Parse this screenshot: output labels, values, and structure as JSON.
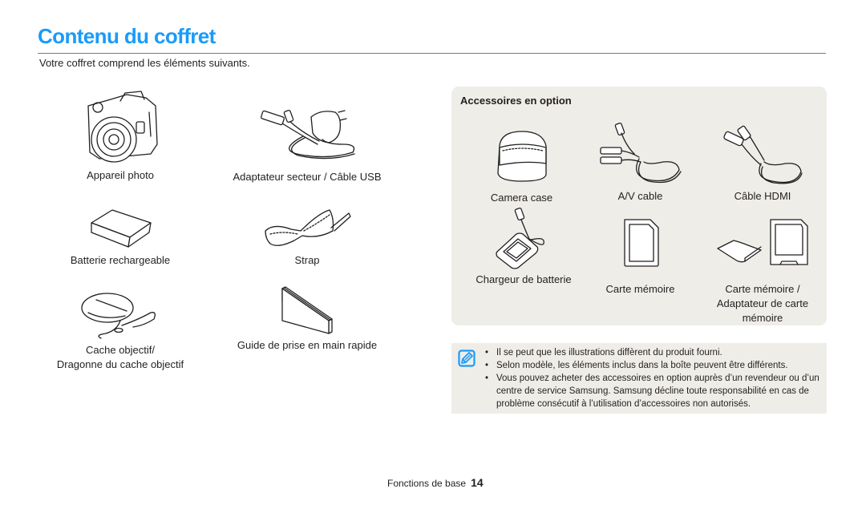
{
  "page": {
    "title": "Contenu du coffret",
    "intro": "Votre coffret comprend les éléments suivants.",
    "accent_color": "#1a9bfa",
    "panel_color": "#efede8"
  },
  "included_items": [
    {
      "icon": "camera-icon",
      "label": "Appareil photo"
    },
    {
      "icon": "adapter-usb-cable-icon",
      "label": "Adaptateur secteur / Câble USB"
    },
    {
      "icon": "battery-icon",
      "label": "Batterie rechargeable"
    },
    {
      "icon": "strap-icon",
      "label": "Strap"
    },
    {
      "icon": "lens-cap-icon",
      "label_line1": "Cache objectif/",
      "label_line2": "Dragonne du cache objectif"
    },
    {
      "icon": "quick-guide-icon",
      "label": "Guide de prise en main rapide"
    }
  ],
  "optional": {
    "heading": "Accessoires en option",
    "items": [
      {
        "icon": "camera-case-icon",
        "label": "Camera case"
      },
      {
        "icon": "av-cable-icon",
        "label": "A/V cable"
      },
      {
        "icon": "hdmi-cable-icon",
        "label": "Câble HDMI"
      },
      {
        "icon": "battery-charger-icon",
        "label": "Chargeur de batterie"
      },
      {
        "icon": "memory-card-icon",
        "label": "Carte mémoire"
      },
      {
        "icon": "memory-card-adapter-icon",
        "label_line1": "Carte mémoire /",
        "label_line2": "Adaptateur de carte",
        "label_line3": "mémoire"
      }
    ]
  },
  "note": {
    "icon": "note-pencil-icon",
    "bullets": [
      "Il se peut que les illustrations diffèrent du produit fourni.",
      "Selon modèle, les éléments inclus dans la boîte peuvent être différents.",
      "Vous pouvez acheter des accessoires en option auprès d’un revendeur ou d’un centre de service Samsung. Samsung décline toute responsabilité en cas de problème consécutif à l’utilisation d’accessoires non autorisés."
    ]
  },
  "footer": {
    "section": "Fonctions de base",
    "page_number": "14"
  }
}
